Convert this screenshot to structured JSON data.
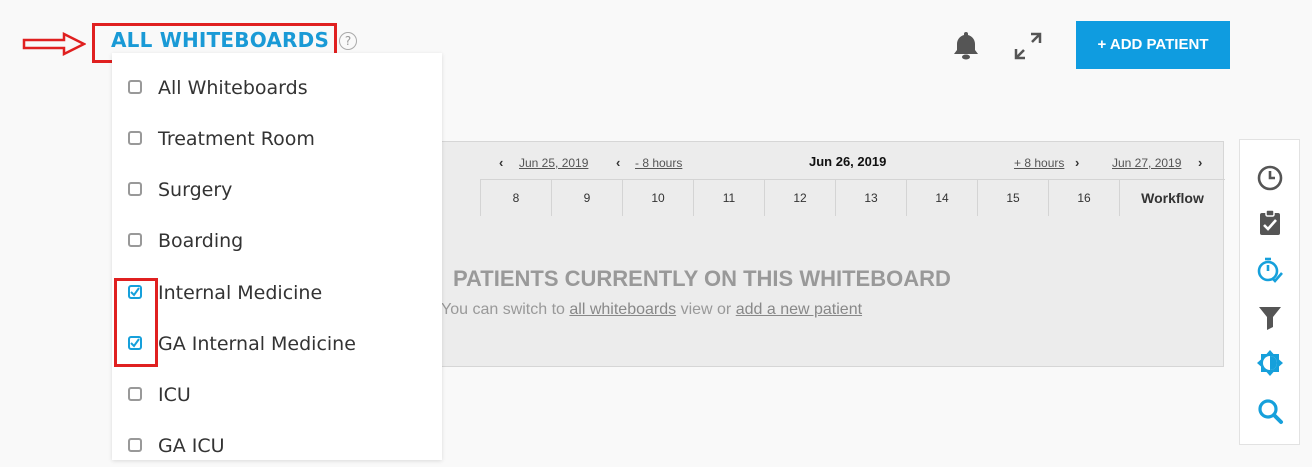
{
  "header": {
    "title": "ALL WHITEBOARDS",
    "help": "?",
    "add_button": "+ ADD PATIENT"
  },
  "dropdown": {
    "options": [
      {
        "label": "All Whiteboards",
        "checked": false
      },
      {
        "label": "Treatment Room",
        "checked": false
      },
      {
        "label": "Surgery",
        "checked": false
      },
      {
        "label": "Boarding",
        "checked": false
      },
      {
        "label": "Internal Medicine",
        "checked": true
      },
      {
        "label": "GA Internal Medicine",
        "checked": true
      },
      {
        "label": "ICU",
        "checked": false
      },
      {
        "label": "GA ICU",
        "checked": false
      }
    ]
  },
  "board": {
    "prev_day": "Jun 25, 2019",
    "minus_hours": "- 8 hours",
    "current_day": "Jun 26, 2019",
    "plus_hours": "+ 8 hours",
    "next_day": "Jun 27, 2019",
    "hours": [
      "8",
      "9",
      "10",
      "11",
      "12",
      "13",
      "14",
      "15",
      "16"
    ],
    "workflow": "Workflow",
    "empty_title": "PATIENTS CURRENTLY ON THIS WHITEBOARD",
    "empty_sub_prefix": "You can switch to",
    "empty_sub_link1": "all whiteboards",
    "empty_sub_mid": "view or",
    "empty_sub_link2": "add a new patient"
  },
  "toolbar": {
    "icons": [
      "clock-icon",
      "clipboard-check-icon",
      "timer-check-icon",
      "filter-icon",
      "contrast-icon",
      "search-icon"
    ]
  },
  "colors": {
    "accent": "#1a9ad6",
    "button": "#0f9ce0",
    "highlight": "#e02020"
  }
}
